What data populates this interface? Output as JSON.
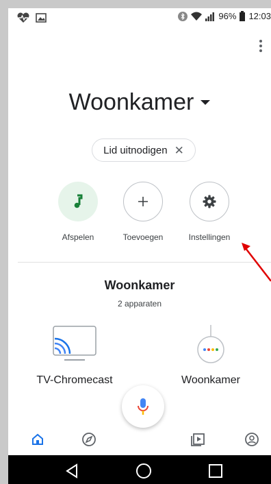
{
  "status_bar": {
    "battery_text": "96%",
    "time": "12:03",
    "left_icons": [
      "heart-monitor-icon",
      "image-icon"
    ],
    "right_icons": [
      "bluetooth-icon",
      "wifi-icon",
      "signal-icon",
      "battery-icon"
    ]
  },
  "header": {
    "home_name": "Woonkamer",
    "invite_chip_label": "Lid uitnodigen",
    "invite_chip_close": "✕"
  },
  "actions": [
    {
      "label": "Afspelen",
      "icon": "music-note-icon"
    },
    {
      "label": "Toevoegen",
      "icon": "plus-icon"
    },
    {
      "label": "Instellingen",
      "icon": "gear-icon"
    }
  ],
  "room": {
    "title": "Woonkamer",
    "subtitle": "2 apparaten",
    "devices": [
      {
        "name": "TV-Chromecast",
        "icon": "tv-cast-icon"
      },
      {
        "name": "Woonkamer",
        "icon": "google-home-mini-icon"
      }
    ]
  },
  "bottom_nav": [
    "home-icon",
    "explore-compass-icon",
    "media-icon",
    "account-icon"
  ],
  "colors": {
    "accent_blue": "#1a73e8",
    "green": "#188038",
    "green_bg": "#e6f4ea",
    "annotation_arrow": "#e00000"
  }
}
